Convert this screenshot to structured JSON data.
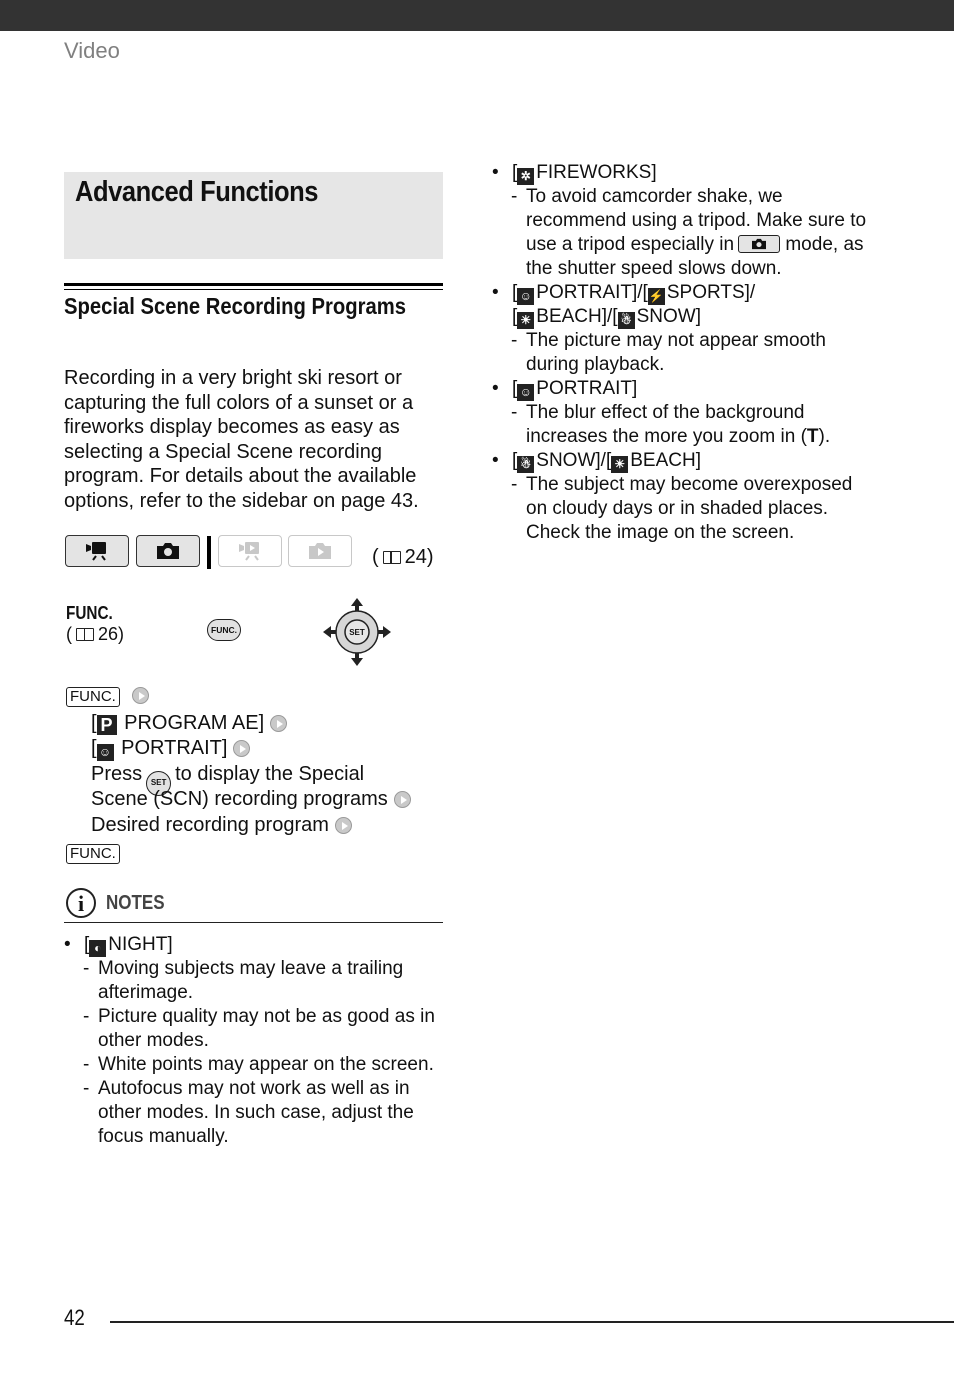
{
  "header": {
    "section": "Video"
  },
  "title": "Advanced Functions",
  "subtitle": "Special Scene Recording Programs",
  "intro": "Recording in a very bright ski resort or capturing the full colors of a sunset or a fireworks display becomes as easy as selecting a Special Scene recording program. For details about the available options, refer to the sidebar on page 43.",
  "modes": {
    "buttons": [
      {
        "icon": "movie-record-icon",
        "active": true
      },
      {
        "icon": "photo-record-icon",
        "active": true
      },
      {
        "icon": "movie-playback-icon",
        "active": false
      },
      {
        "icon": "photo-playback-icon",
        "active": false
      }
    ],
    "page_ref": "24"
  },
  "func": {
    "label": "FUNC.",
    "page_ref": "26",
    "button_label": "FUNC.",
    "joystick_center": "SET"
  },
  "steps": {
    "func_tag": "FUNC.",
    "line1": "PROGRAM AE]",
    "line1_icon": "P",
    "line2": "PORTRAIT]",
    "line3_pre": "Press",
    "line3_set": "SET",
    "line3_post": "to display the Special",
    "line4": "Scene (SCN) recording programs",
    "line5": "Desired recording program",
    "func_tag_end": "FUNC."
  },
  "notes": {
    "title": "NOTES",
    "night": {
      "label": "NIGHT]",
      "items": [
        "Moving subjects may leave a trailing afterimage.",
        "Picture quality may not be as good as in other modes.",
        "White points may appear on the screen.",
        "Autofocus may not work as well as in other modes. In such case, adjust the focus manually."
      ]
    },
    "fireworks": {
      "label": "FIREWORKS]",
      "item_pre": "To avoid camcorder shake, we recommend using a tripod. Make sure to use a tripod especially in",
      "item_post": "mode, as the shutter speed slows down."
    },
    "group": {
      "portrait": "PORTRAIT]/[",
      "sports": "SPORTS]/",
      "beach": "BEACH]/[",
      "snow": "SNOW]",
      "item": "The picture may not appear smooth during playback."
    },
    "portrait": {
      "label": "PORTRAIT]",
      "item_pre": "The blur effect of the background increases the more you zoom in (",
      "item_key": "T",
      "item_post": ")."
    },
    "snow_beach": {
      "snow": "SNOW]/[",
      "beach": "BEACH]",
      "item": "The subject may become overexposed on cloudy days or in shaded places. Check the image on the screen."
    }
  },
  "footer": {
    "page_number": "42"
  }
}
